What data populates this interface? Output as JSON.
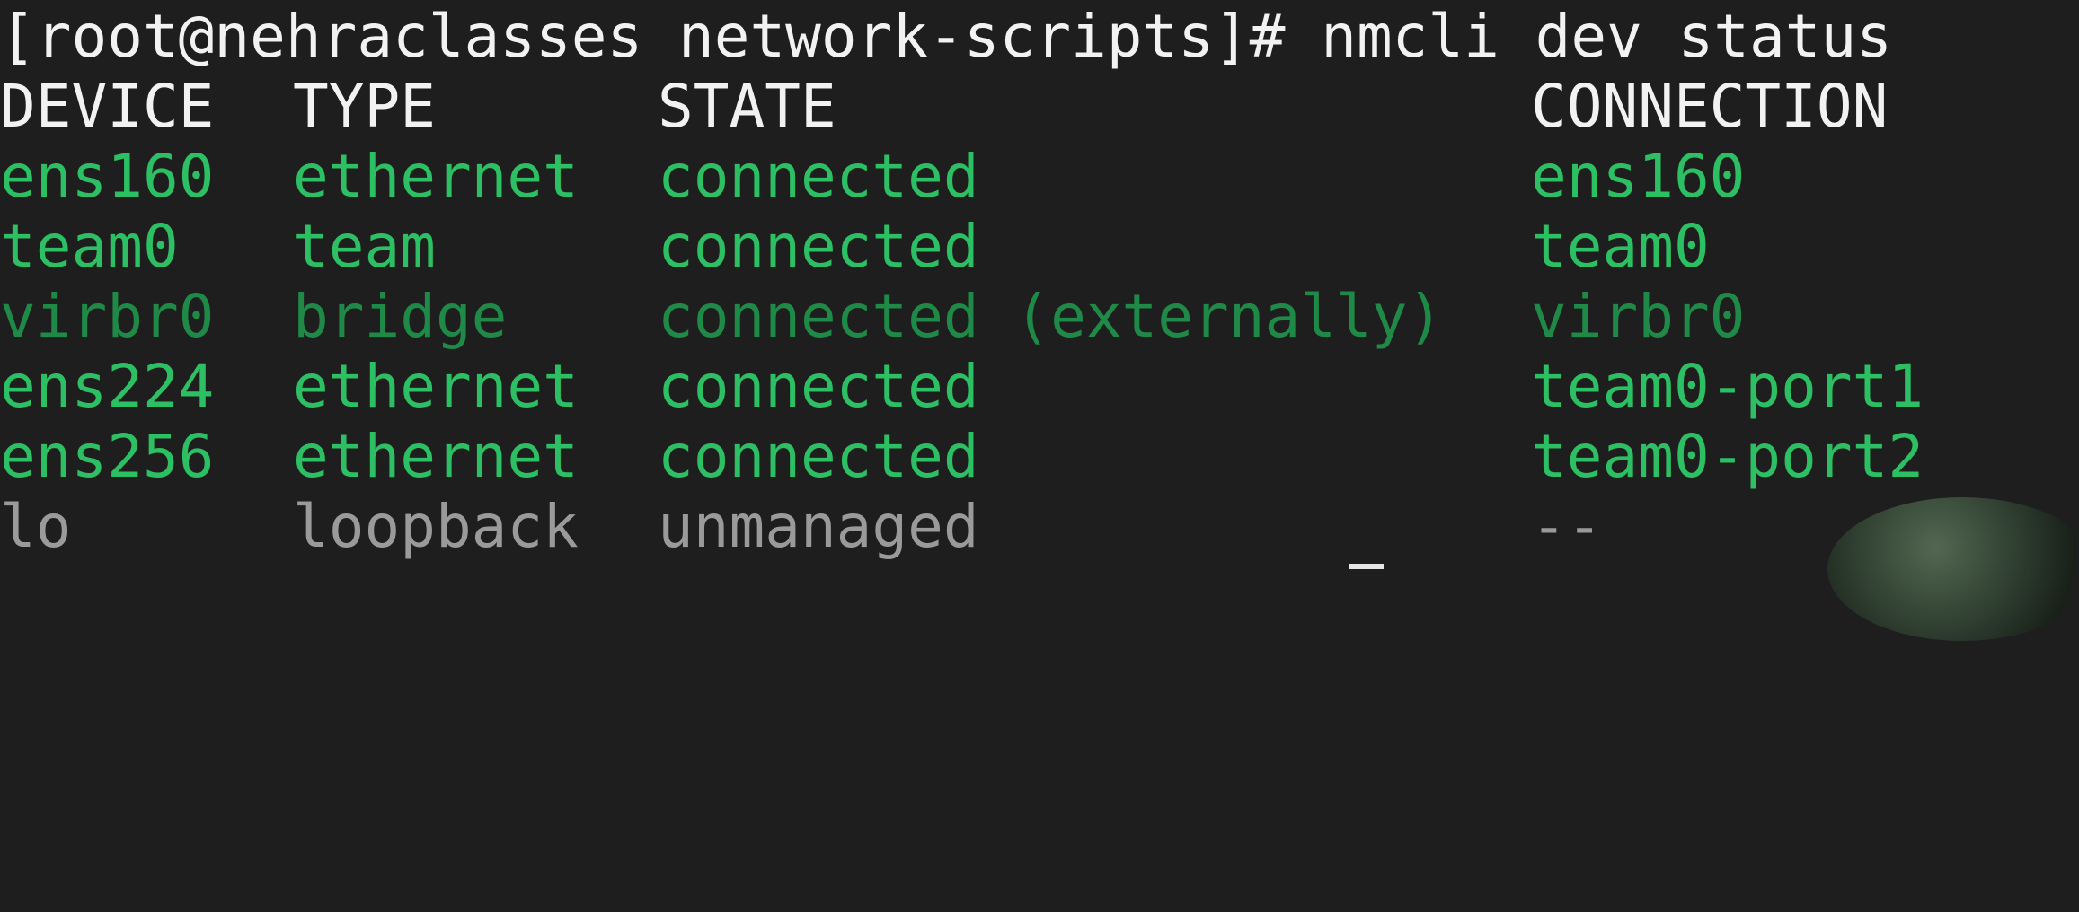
{
  "terminal": {
    "prompt_line": "[root@nehraclasses network-scripts]# nmcli dev status",
    "header": {
      "device": "DEVICE",
      "type": "TYPE",
      "state": "STATE",
      "connection": "CONNECTION"
    },
    "rows": [
      {
        "device": "ens160",
        "type": "ethernet",
        "state": "connected",
        "connection": "ens160",
        "color": "#2dbf63"
      },
      {
        "device": "team0",
        "type": "team",
        "state": "connected",
        "connection": "team0",
        "color": "#2dbf63"
      },
      {
        "device": "virbr0",
        "type": "bridge",
        "state": "connected (externally)",
        "connection": "virbr0",
        "color": "#1f8a47"
      },
      {
        "device": "ens224",
        "type": "ethernet",
        "state": "connected",
        "connection": "team0-port1",
        "color": "#2dbf63"
      },
      {
        "device": "ens256",
        "type": "ethernet",
        "state": "connected",
        "connection": "team0-port2",
        "color": "#2dbf63"
      },
      {
        "device": "lo",
        "type": "loopback",
        "state": "unmanaged",
        "connection": "--",
        "color": "#9a9a9a"
      }
    ],
    "background_color": "#1e1e1e",
    "text_color": "#f2f2f2"
  }
}
